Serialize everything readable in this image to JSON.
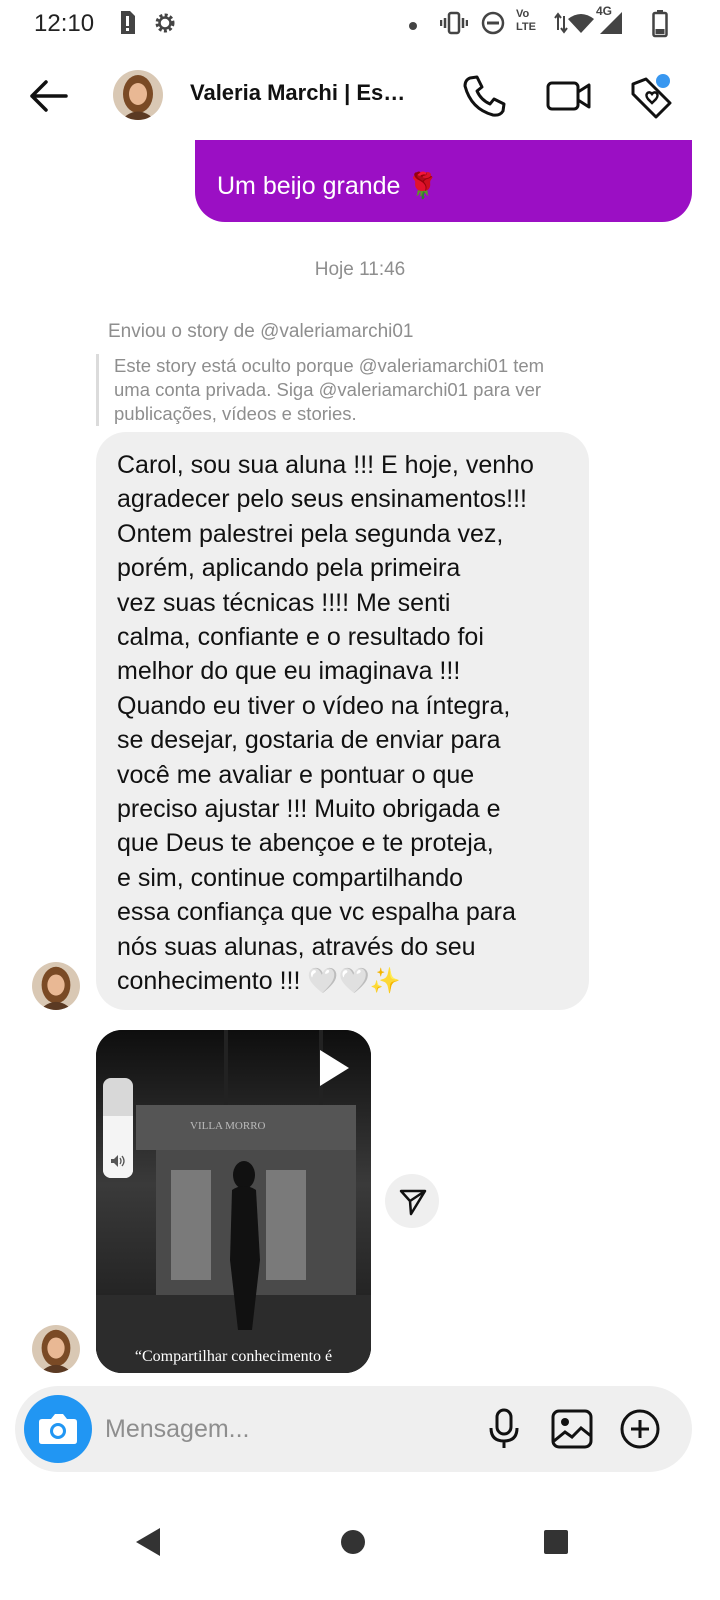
{
  "status_bar": {
    "time": "12:10",
    "volte_line1": "Vo",
    "volte_line2": "LTE",
    "network": "4G",
    "icons": [
      "sd-card-alert-icon",
      "settings-gear-icon",
      "notification-dot-icon",
      "vibrate-icon",
      "do-not-disturb-icon",
      "volte-icon",
      "data-arrows-icon",
      "wifi-icon",
      "signal-icon",
      "battery-icon"
    ]
  },
  "header": {
    "contact_name": "Valeria Marchi | Esp…",
    "icons": [
      "back-arrow-icon",
      "phone-call-icon",
      "video-call-icon",
      "heart-tag-icon"
    ],
    "accent_dot_color": "#3897f0"
  },
  "messages": {
    "sent": {
      "text": "Um beijo grande",
      "emoji": "🌹",
      "bubble_color": "#9b0fc4"
    },
    "timestamp": "Hoje 11:46",
    "story_reply": {
      "note": "Enviou o story de @valeriamarchi01",
      "hidden_lines": [
        "Este story está oculto porque @valeriamarchi01 tem",
        "uma conta privada. Siga @valeriamarchi01 para ver",
        "publicações, vídeos e stories."
      ]
    },
    "received": {
      "lines": [
        "Carol, sou sua aluna !!! E hoje, venho",
        "agradecer pelo seus ensinamentos!!!",
        "Ontem palestrei pela segunda vez,",
        "porém, aplicando pela primeira",
        "vez suas técnicas !!!! Me senti",
        "calma, confiante e o resultado foi",
        "melhor do que eu imaginava !!!",
        "Quando eu tiver o vídeo na íntegra,",
        "se desejar, gostaria de enviar para",
        "você me avaliar e pontuar o que",
        "preciso ajustar !!! Muito obrigada e",
        "que Deus te abençoe e te proteja,",
        "e sim, continue compartilhando",
        "essa confiança que vc espalha para",
        "nós suas alunas, através do seu",
        "conhecimento !!! 🤍🤍✨"
      ],
      "bubble_color": "#efefef"
    },
    "video": {
      "caption": "“Compartilhar conhecimento é",
      "sign_text": "VILLA MORRO",
      "volume_level_percent": 62,
      "icons": [
        "play-icon",
        "volume-icon",
        "send-share-icon"
      ]
    }
  },
  "composer": {
    "placeholder": "Mensagem...",
    "value": "",
    "camera_color": "#2196f3",
    "icons": [
      "camera-icon",
      "microphone-icon",
      "gallery-icon",
      "add-circle-icon"
    ]
  },
  "nav_bar": {
    "icons": [
      "nav-back-icon",
      "nav-home-icon",
      "nav-recents-icon"
    ]
  }
}
